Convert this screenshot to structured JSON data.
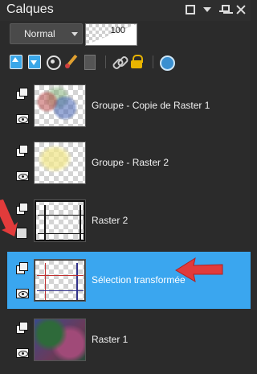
{
  "panel": {
    "title": "Calques"
  },
  "titlebar_icons": [
    "restore-icon",
    "dropdown-icon",
    "pin-icon",
    "close-icon"
  ],
  "blend_mode": {
    "value": "Normal"
  },
  "opacity": {
    "value": "100"
  },
  "toolbar": {
    "tools": [
      "move-layer-up-icon",
      "move-layer-down-icon",
      "visibility-icon",
      "edit-icon",
      "mask-icon",
      "link-icon",
      "lock-icon",
      "layer-options-icon"
    ]
  },
  "layers": [
    {
      "name": "Groupe - Copie de Raster 1",
      "type": "group",
      "visible": true,
      "selected": false
    },
    {
      "name": "Groupe - Raster 2",
      "type": "group",
      "visible": true,
      "selected": false
    },
    {
      "name": "Raster 2",
      "type": "raster",
      "visible": false,
      "selected": false
    },
    {
      "name": "Sélection transformée",
      "type": "raster",
      "visible": true,
      "selected": true
    },
    {
      "name": "Raster 1",
      "type": "raster",
      "visible": true,
      "selected": false
    }
  ],
  "colors": {
    "panel_bg": "#2b2b2b",
    "selection": "#3aa6ef",
    "annotation_arrow": "#e23b3b"
  }
}
